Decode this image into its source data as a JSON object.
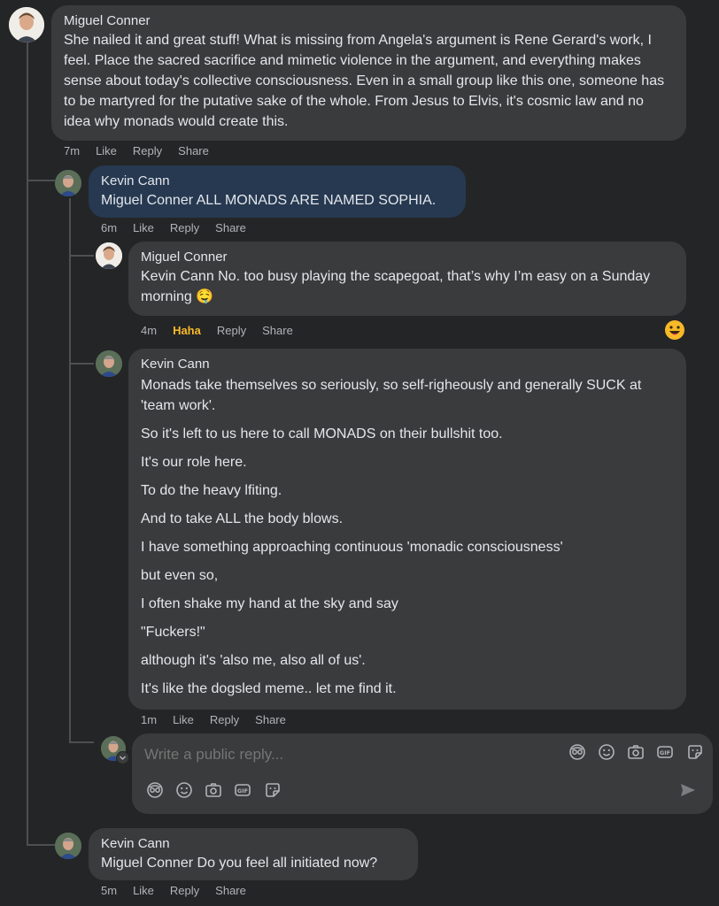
{
  "comments": [
    {
      "author": "Miguel Conner",
      "text": "She nailed it and great stuff! What is missing from Angela's argument is Rene Gerard's work, I feel. Place the sacred sacrifice and mimetic violence in the argument, and everything makes sense about today's collective consciousness. Even in a small group like this one, someone has to be martyred for the putative sake of the whole. From Jesus to Elvis, it's cosmic law and no idea why monads would create this.",
      "time": "7m",
      "like": "Like",
      "reply": "Reply",
      "share": "Share"
    },
    {
      "author": "Kevin Cann",
      "mention": "Miguel Conner",
      "text": " ALL MONADS ARE NAMED SOPHIA.",
      "time": "6m",
      "like": "Like",
      "reply": "Reply",
      "share": "Share"
    },
    {
      "author": "Miguel Conner",
      "mention": "Kevin Cann",
      "text": " No. too busy playing the scapegoat, that’s why I’m easy on a Sunday morning",
      "emoji": "🤤",
      "time": "4m",
      "reaction": "Haha",
      "reply": "Reply",
      "share": "Share"
    },
    {
      "author": "Kevin Cann",
      "paragraphs": [
        "Monads take themselves so seriously, so self-righeously and generally SUCK at 'team work'.",
        "So it's left to us here to call MONADS on their bullshit too.",
        "It's our role here.",
        "To do the heavy lfiting.",
        "And to take ALL the body blows.",
        "I have something approaching continuous 'monadic consciousness'",
        "but even so,",
        "I often shake my hand at the sky and say",
        "\"Fuckers!\"",
        "although it's 'also me, also all of us'.",
        "It's like the dogsled meme.. let me find it."
      ],
      "time": "1m",
      "like": "Like",
      "reply": "Reply",
      "share": "Share"
    },
    {
      "author": "Kevin Cann",
      "mention": "Miguel Conner",
      "text": " Do you feel all initiated now?",
      "time": "5m",
      "like": "Like",
      "reply": "Reply",
      "share": "Share"
    }
  ],
  "reply_box": {
    "placeholder": "Write a public reply...",
    "icons": [
      "avatar-sticker-icon",
      "emoji-icon",
      "camera-icon",
      "gif-icon",
      "sticker-icon"
    ]
  },
  "colors": {
    "background": "#242526",
    "bubble": "#3a3b3c",
    "selected_bubble": "#263951",
    "meta": "#b0b3b8",
    "haha": "#f7b928"
  }
}
